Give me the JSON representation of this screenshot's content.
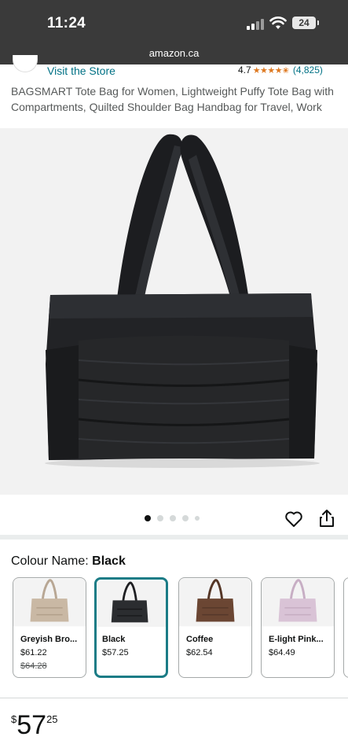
{
  "status_bar": {
    "time": "11:24",
    "battery": "24"
  },
  "browser": {
    "url": "amazon.ca"
  },
  "store": {
    "visit_label": "Visit the Store",
    "rating_value": "4.7",
    "rating_stars": "★★★★✬",
    "rating_count": "(4,825)"
  },
  "product": {
    "title": "BAGSMART Tote Bag for Women, Lightweight Puffy Tote Bag with Compartments, Quilted Shoulder Bag Handbag for Travel, Work",
    "image_count": 5,
    "active_image": 1
  },
  "colour": {
    "label": "Colour Name: ",
    "selected": "Black"
  },
  "swatches": [
    {
      "name": "Greyish Bro...",
      "price": "$61.22",
      "old_price": "$64.28",
      "color": "#c9b8a4"
    },
    {
      "name": "Black",
      "price": "$57.25",
      "color": "#2b2d30"
    },
    {
      "name": "Coffee",
      "price": "$62.54",
      "color": "#6b4633"
    },
    {
      "name": "E-light Pink...",
      "price": "$64.49",
      "color": "#d9c3d6"
    }
  ],
  "price": {
    "currency": "$",
    "whole": "57",
    "fraction": "25"
  },
  "colors": {
    "link": "#007185",
    "star": "#de7921",
    "selected_border": "#1b7c86"
  }
}
